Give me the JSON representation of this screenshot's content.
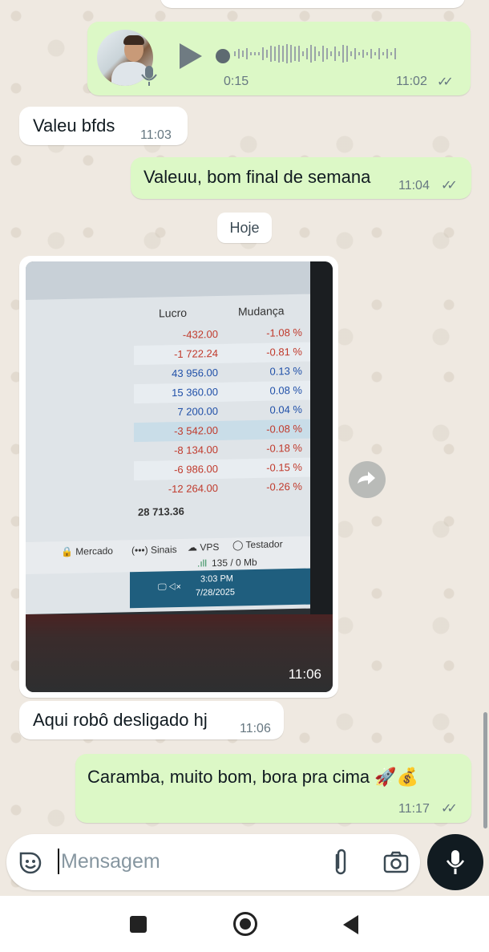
{
  "messages": {
    "audio": {
      "duration": "0:15",
      "time": "11:02"
    },
    "m1": {
      "text": "Valeu bfds",
      "time": "11:03"
    },
    "m2": {
      "text": "Valeuu, bom final de semana",
      "time": "11:04"
    },
    "day_chip": "Hoje",
    "photo": {
      "time": "11:06",
      "table": {
        "headers": [
          "Lucro",
          "Mudança"
        ],
        "rows": [
          [
            "-432.00",
            "-1.08 %"
          ],
          [
            "-1 722.24",
            "-0.81 %"
          ],
          [
            "43 956.00",
            "0.13 %"
          ],
          [
            "15 360.00",
            "0.08 %"
          ],
          [
            "7 200.00",
            "0.04 %"
          ],
          [
            "-3 542.00",
            "-0.08 %"
          ],
          [
            "-8 134.00",
            "-0.18 %"
          ],
          [
            "-6 986.00",
            "-0.15 %"
          ],
          [
            "-12 264.00",
            "-0.26 %"
          ]
        ],
        "total": "28 713.36"
      },
      "statusbar": {
        "mercado": "Mercado",
        "sinais": "Sinais",
        "vps": "VPS",
        "testador": "Testador",
        "traffic": "135 / 0 Mb"
      },
      "taskbar": {
        "clock": "3:03 PM",
        "date": "7/28/2025"
      }
    },
    "m3": {
      "text": "Aqui robô desligado hj",
      "time": "11:06"
    },
    "m4": {
      "text": "Caramba, muito bom, bora pra cima 🚀💰",
      "time": "11:17"
    }
  },
  "input": {
    "placeholder": "Mensagem"
  },
  "icons": [
    "emoji-icon",
    "attach-icon",
    "camera-icon",
    "mic-icon",
    "forward-icon",
    "play-icon",
    "double-check-icon",
    "nav-square-icon",
    "nav-home-icon",
    "nav-back-icon"
  ],
  "colors": {
    "outgoing": "#dcf8c6",
    "incoming": "#ffffff",
    "background": "#efeae2"
  }
}
